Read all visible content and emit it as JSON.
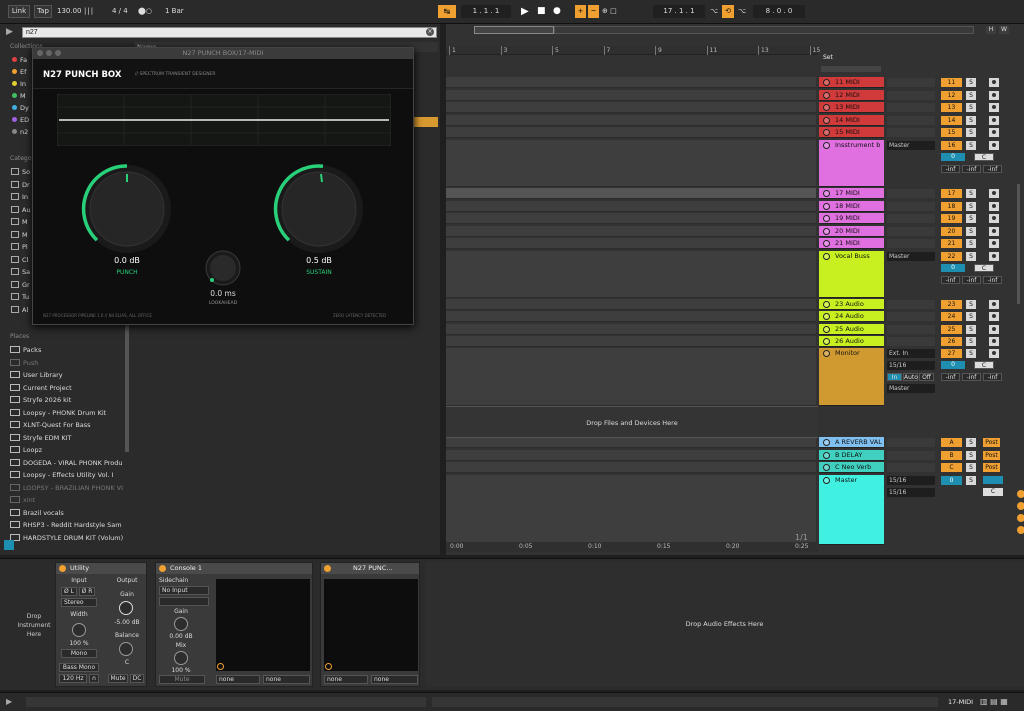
{
  "transport": {
    "link": "Link",
    "tap": "Tap",
    "tempo": "130.00",
    "signature": "4 / 4",
    "quant": "1 Bar",
    "position": "1 .   1 .   1",
    "loop_start": "17 .   1 .   1",
    "loop_len": "8 .   0 .   0"
  },
  "browser": {
    "search_value": "n27",
    "collections_label": "Collections",
    "name_col": "Name",
    "categories_label": "Categories",
    "places_label": "Places",
    "collections": [
      {
        "label": "Fa",
        "color": "#e04040"
      },
      {
        "label": "Ef",
        "color": "#f0a030"
      },
      {
        "label": "In",
        "color": "#e0d030"
      },
      {
        "label": "M",
        "color": "#40c060"
      },
      {
        "label": "Dy",
        "color": "#40b0e0"
      },
      {
        "label": "ED",
        "color": "#a060e0"
      },
      {
        "label": "n2",
        "color": "#888888"
      }
    ],
    "categories": [
      "So",
      "Dr",
      "In",
      "Au",
      "M",
      "M",
      "Pl",
      "Cl",
      "Sa",
      "Gr",
      "Tu",
      "Al"
    ],
    "places": [
      {
        "label": "Packs",
        "dim": false
      },
      {
        "label": "Push",
        "dim": true
      },
      {
        "label": "User Library",
        "dim": false
      },
      {
        "label": "Current Project",
        "dim": false
      },
      {
        "label": "Stryfe 2026 kit",
        "dim": false
      },
      {
        "label": "Loopsy - PHONK Drum Kit",
        "dim": false
      },
      {
        "label": "XLNT-Quest For Bass",
        "dim": false
      },
      {
        "label": "Stryfe EDM KIT",
        "dim": false
      },
      {
        "label": "Loopz",
        "dim": false
      },
      {
        "label": "DOGEDA - VIRAL PHONK Produ",
        "dim": false
      },
      {
        "label": "Loopsy - Effects Utility Vol. I",
        "dim": false
      },
      {
        "label": "LOOPSY - BRAZILIAN PHONK VI",
        "dim": true
      },
      {
        "label": "xint",
        "dim": true
      },
      {
        "label": "Brazil vocals",
        "dim": false
      },
      {
        "label": "RHSP3 - Reddit Hardstyle Sam",
        "dim": false
      },
      {
        "label": "HARDSTYLE DRUM KIT (Volum)",
        "dim": false
      }
    ]
  },
  "plugin": {
    "window_title": "N27 PUNCH BOX/17-MIDI",
    "name": "N27 PUNCH BOX",
    "subtitle": "// SPECTRUM TRANSIENT DESIGNER",
    "punch_value": "0.0 dB",
    "punch_label": "PUNCH",
    "sustain_value": "0.5 dB",
    "sustain_label": "SUSTAIN",
    "lookahead_value": "0.0 ms",
    "lookahead_label": "LOOKAHEAD",
    "footer_left": "N27 PROCESSOR PIPELINE 1.0 // N4 ELIAS, ALL OFFICE",
    "footer_right": "ZERO LATENCY DETECTED"
  },
  "arrangement": {
    "ruler": [
      "1",
      "3",
      "5",
      "7",
      "9",
      "11",
      "13",
      "15"
    ],
    "set_label": "Set",
    "drop_label": "Drop Files and Devices Here",
    "time": [
      "0:00",
      "0:05",
      "0:10",
      "0:15",
      "0:20",
      "0:25"
    ],
    "page": "1/1",
    "hw": [
      "H",
      "W"
    ]
  },
  "tracks": [
    {
      "name": "11 MIDI",
      "color": "#d03a3a",
      "num": "11"
    },
    {
      "name": "12 MIDI",
      "color": "#d03a3a",
      "num": "12"
    },
    {
      "name": "13 MIDI",
      "color": "#d03a3a",
      "num": "13"
    },
    {
      "name": "14 MIDI",
      "color": "#d03a3a",
      "num": "14"
    },
    {
      "name": "15 MIDI",
      "color": "#d03a3a",
      "num": "15"
    },
    {
      "name": "Insstrument b",
      "color": "#e070e0",
      "num": "16",
      "route": "Master",
      "vol": "0",
      "pan": "C"
    },
    {
      "name": "17 MIDI",
      "color": "#e070e0",
      "num": "17"
    },
    {
      "name": "18 MIDI",
      "color": "#e070e0",
      "num": "18"
    },
    {
      "name": "19 MIDI",
      "color": "#e070e0",
      "num": "19"
    },
    {
      "name": "20 MIDI",
      "color": "#e070e0",
      "num": "20"
    },
    {
      "name": "21 MIDI",
      "color": "#e070e0",
      "num": "21"
    },
    {
      "name": "Vocal Buss",
      "color": "#c8f020",
      "num": "22",
      "route": "Master",
      "vol": "0",
      "pan": "C"
    },
    {
      "name": "23 Audio",
      "color": "#c8f020",
      "num": "23"
    },
    {
      "name": "24 Audio",
      "color": "#c8f020",
      "num": "24"
    },
    {
      "name": "25 Audio",
      "color": "#c8f020",
      "num": "25"
    },
    {
      "name": "26 Audio",
      "color": "#c8f020",
      "num": "26"
    },
    {
      "name": "Monitor",
      "color": "#d09a30",
      "num": "27",
      "route": "Ext. In",
      "sub": "15/16",
      "out": "Master",
      "vol": "0",
      "pan": "C",
      "mon": [
        "In",
        "Auto",
        "Off"
      ]
    },
    {
      "name": "A REVERB VAL",
      "color": "#80c0f0",
      "num": "A",
      "post": "Post"
    },
    {
      "name": "B DELAY",
      "color": "#40d0c0",
      "num": "B",
      "post": "Post"
    },
    {
      "name": "C Neo Verb",
      "color": "#40d0c0",
      "num": "C",
      "post": "Post"
    },
    {
      "name": "Master",
      "color": "#40f0e0",
      "num": "0",
      "route": "15/16",
      "sub": "15/16",
      "pan": "C"
    }
  ],
  "inf": "-inf",
  "devices": {
    "utility": {
      "title": "Utility",
      "input": "Input",
      "output": "Output",
      "phase_l": "Ø L",
      "phase_r": "Ø R",
      "mode": "Stereo",
      "gain_label": "Gain",
      "gain_value": "-5.00 dB",
      "width_label": "Width",
      "width_value": "100 %",
      "balance_label": "Balance",
      "balance_value": "C",
      "mono": "Mono",
      "bass_mono": "Bass Mono",
      "freq": "120 Hz",
      "mute": "Mute",
      "dc": "DC"
    },
    "console": {
      "title": "Console 1",
      "sidechain": "Sidechain",
      "input": "No Input",
      "gain_label": "Gain",
      "gain_value": "0.00 dB",
      "mix_label": "Mix",
      "mix_value": "100 %",
      "mute": "Mute",
      "none1": "none",
      "none2": "none"
    },
    "punch": {
      "title": "N27 PUNC...",
      "none1": "none",
      "none2": "none"
    },
    "drop_instrument": "Drop Instrument Here",
    "drop_effects": "Drop Audio Effects Here",
    "track_label": "17-MIDI"
  }
}
